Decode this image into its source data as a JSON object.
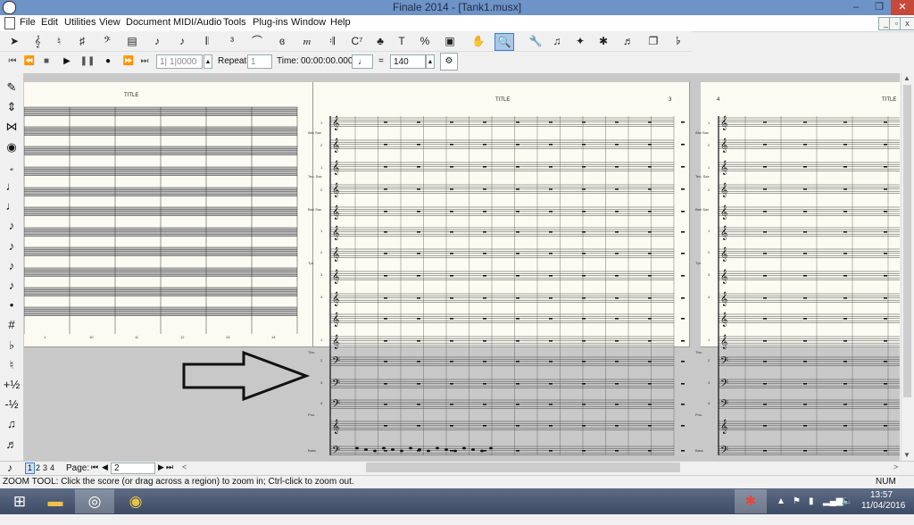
{
  "window": {
    "title": "Finale 2014 - [Tank1.musx]",
    "minimize": "–",
    "restore": "❐",
    "close": "✕"
  },
  "menubar": {
    "items": [
      "File",
      "Edit",
      "Utilities",
      "View",
      "Document",
      "MIDI/Audio",
      "Tools",
      "Plug-ins",
      "Window",
      "Help"
    ]
  },
  "toolbar": {
    "tools": [
      {
        "name": "selection-tool",
        "glyph": "➤",
        "active": false
      },
      {
        "name": "staff-tool",
        "glyph": "𝄞",
        "active": false
      },
      {
        "name": "key-signature-tool",
        "glyph": "♮",
        "active": false
      },
      {
        "name": "time-signature-tool",
        "glyph": "♯",
        "active": false
      },
      {
        "name": "clef-tool",
        "glyph": "𝄢",
        "active": false
      },
      {
        "name": "measure-tool",
        "glyph": "▤",
        "active": false
      },
      {
        "name": "simple-entry-tool",
        "glyph": "♪",
        "active": false
      },
      {
        "name": "speedy-entry-tool",
        "glyph": "♪",
        "active": false
      },
      {
        "name": "hyperscribe-tool",
        "glyph": "𝄃",
        "active": false
      },
      {
        "name": "tuplet-tool",
        "glyph": "³",
        "active": false
      },
      {
        "name": "smart-shape-tool",
        "glyph": "⌒",
        "active": false
      },
      {
        "name": "articulation-tool",
        "glyph": "ɞ",
        "active": false
      },
      {
        "name": "expression-tool",
        "glyph": "𝆐",
        "active": false
      },
      {
        "name": "repeat-tool",
        "glyph": "𝄇",
        "active": false
      },
      {
        "name": "chord-tool",
        "glyph": "C⁷",
        "active": false
      },
      {
        "name": "lyrics-tool",
        "glyph": "♣",
        "active": false
      },
      {
        "name": "text-tool",
        "glyph": "T",
        "active": false
      },
      {
        "name": "resize-tool",
        "glyph": "%",
        "active": false
      },
      {
        "name": "graphics-tool",
        "glyph": "▣",
        "active": false
      },
      {
        "name": "hand-grabber-tool",
        "glyph": "✋",
        "active": false
      },
      {
        "name": "zoom-tool",
        "glyph": "🔍",
        "active": true
      },
      {
        "name": "special-tools-tool",
        "glyph": "🔧",
        "active": false
      },
      {
        "name": "note-mover-tool",
        "glyph": "♫",
        "active": false
      },
      {
        "name": "mirror-tool",
        "glyph": "✦",
        "active": false
      },
      {
        "name": "midi-tool",
        "glyph": "✱",
        "active": false
      },
      {
        "name": "ossia-tool",
        "glyph": "♬",
        "active": false
      },
      {
        "name": "page-layout-tool",
        "glyph": "❐",
        "active": false
      },
      {
        "name": "mass-edit-tool",
        "glyph": "𝄬",
        "active": false
      }
    ]
  },
  "playback": {
    "counter": "1| 1|0000",
    "repeat_label": "Repeat:",
    "repeat_value": "1",
    "time_label": "Time:",
    "time_value": "00:00:00.000",
    "equals": "=",
    "tempo": "140"
  },
  "palette": {
    "items": [
      {
        "name": "eraser-icon",
        "glyph": "✎"
      },
      {
        "name": "half-step-icon",
        "glyph": "⇕"
      },
      {
        "name": "tie-icon",
        "glyph": "⋈"
      },
      {
        "name": "rest-icon",
        "glyph": "◉"
      },
      {
        "name": "whole-note-icon",
        "glyph": "𝅗"
      },
      {
        "name": "half-note-icon",
        "glyph": "♩"
      },
      {
        "name": "quarter-note-icon",
        "glyph": "♩"
      },
      {
        "name": "eighth-note-icon",
        "glyph": "♪"
      },
      {
        "name": "sixteenth-note-icon",
        "glyph": "♪"
      },
      {
        "name": "thirty-second-note-icon",
        "glyph": "♪"
      },
      {
        "name": "sixty-fourth-note-icon",
        "glyph": "♪"
      },
      {
        "name": "dot-icon",
        "glyph": "•"
      },
      {
        "name": "sharp-icon",
        "glyph": "#"
      },
      {
        "name": "flat-icon",
        "glyph": "♭"
      },
      {
        "name": "natural-icon",
        "glyph": "♮"
      },
      {
        "name": "raise-half-step-icon",
        "glyph": "+½"
      },
      {
        "name": "lower-half-step-icon",
        "glyph": "-½"
      },
      {
        "name": "tuplet-icon",
        "glyph": "♫"
      },
      {
        "name": "beamed-notes-icon",
        "glyph": "♬"
      },
      {
        "name": "grace-note-icon",
        "glyph": "♪"
      }
    ]
  },
  "score": {
    "page1_title": "TITLE",
    "page2_title": "TITLE",
    "page2_number": "3",
    "page3_title": "TITLE",
    "page3_number": "4",
    "measure_numbers": [
      "1",
      "10",
      "11",
      "12",
      "13",
      "14"
    ],
    "staff_labels": [
      "Alto Sax",
      "Ten. Sax",
      "Bari Sax",
      "Tpt.",
      "Tbn.",
      "Pno.",
      "Bass"
    ],
    "staff_numbers": [
      "1",
      "2",
      "1",
      "2",
      "1",
      "2",
      "3",
      "4",
      "1",
      "2",
      "3",
      "4"
    ]
  },
  "pagenav": {
    "views": [
      "1",
      "2",
      "3",
      "4"
    ],
    "page_label": "Page:",
    "page_value": "2"
  },
  "status": {
    "message": "ZOOM TOOL: Click the score (or drag across a region) to zoom in; Ctrl-click to zoom out.",
    "num": "NUM"
  },
  "taskbar": {
    "time": "13:57",
    "date": "11/04/2016"
  }
}
